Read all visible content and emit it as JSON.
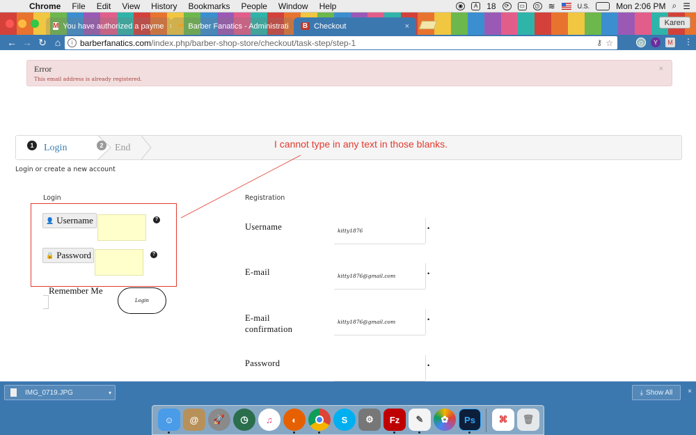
{
  "menubar": {
    "items": [
      "Chrome",
      "File",
      "Edit",
      "View",
      "History",
      "Bookmarks",
      "People",
      "Window",
      "Help"
    ],
    "badge_count": "18",
    "input_source": "U.S.",
    "clock": "Mon 2:06 PM"
  },
  "tabs": [
    {
      "title": "You have authorized a payme",
      "favicon": "M"
    },
    {
      "title": "Barber Fanatics - Administrati",
      "favicon": "✂"
    },
    {
      "title": "Checkout",
      "favicon": "B"
    }
  ],
  "profile": "Karen",
  "url": {
    "host": "barberfanatics.com",
    "path": "/index.php/barber-shop-store/checkout/task-step/step-1"
  },
  "alert": {
    "title": "Error",
    "message": "This email address is already registered."
  },
  "steps": [
    {
      "num": "1",
      "label": "Login"
    },
    {
      "num": "2",
      "label": "End"
    }
  ],
  "annotation": "I cannot type in any text in those blanks.",
  "subtitle": "Login or create a new account",
  "login": {
    "heading": "Login",
    "username_label": "Username",
    "password_label": "Password",
    "remember_label": "Remember Me",
    "button": "Login"
  },
  "registration": {
    "heading": "Registration",
    "fields": [
      {
        "label": "Username",
        "value": "kitty1876"
      },
      {
        "label": "E-mail",
        "value": "kitty1876@gmail.com"
      },
      {
        "label": "E-mail confirmation",
        "value": "kitty1876@gmail.com"
      },
      {
        "label": "Password",
        "value": ""
      }
    ],
    "required_mark": "•"
  },
  "downloads": {
    "file": "IMG_0719.JPG",
    "show_all": "Show All"
  },
  "colors": {
    "accent": "#3c78b0",
    "error_bg": "#f2dede",
    "error_text": "#a94442",
    "annotation": "#e23a2f",
    "input_highlight": "#ffffcc"
  }
}
